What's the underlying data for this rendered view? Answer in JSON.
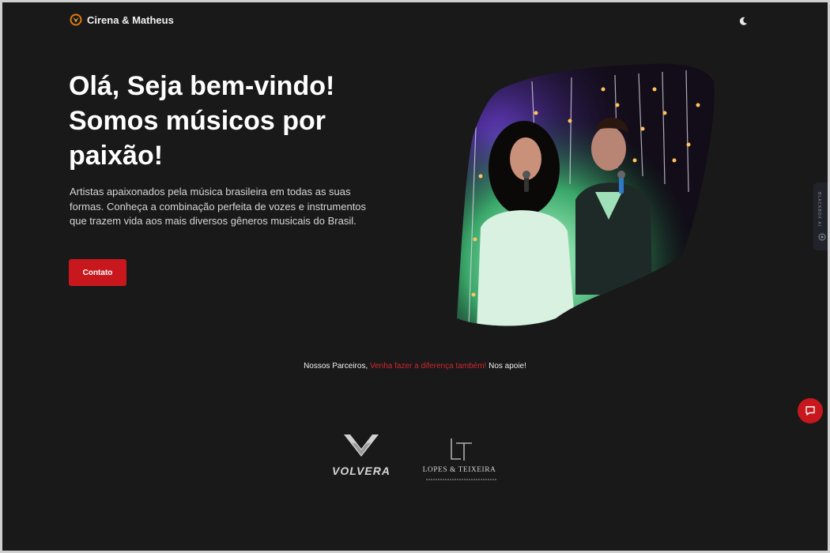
{
  "header": {
    "brand_name": "Cirena & Matheus",
    "logo_icon": "flame-heart-logo",
    "theme_toggle_icon": "moon-icon"
  },
  "hero": {
    "title": "Olá, Seja bem-vindo! Somos músicos por paixão!",
    "description": "Artistas apaixonados pela música brasileira em todas as suas formas. Conheça a combinação perfeita de vozes e instrumentos que trazem vida aos mais diversos gêneros musicais do Brasil.",
    "contact_label": "Contato",
    "image": "singers-photo"
  },
  "partners": {
    "intro": "Nossos Parceiros,",
    "highlight": "Venha fazer a diferença também!",
    "outro": "Nos apoie!",
    "logos": [
      "VOLVERA",
      "LOPES & TEIXEIRA"
    ]
  },
  "widgets": {
    "side_tab_label": "BLACKBOX AI",
    "chat_icon": "chat-bubble-icon"
  },
  "colors": {
    "background": "#191919",
    "accent": "#c8181e",
    "highlight_text": "#d1262b"
  }
}
